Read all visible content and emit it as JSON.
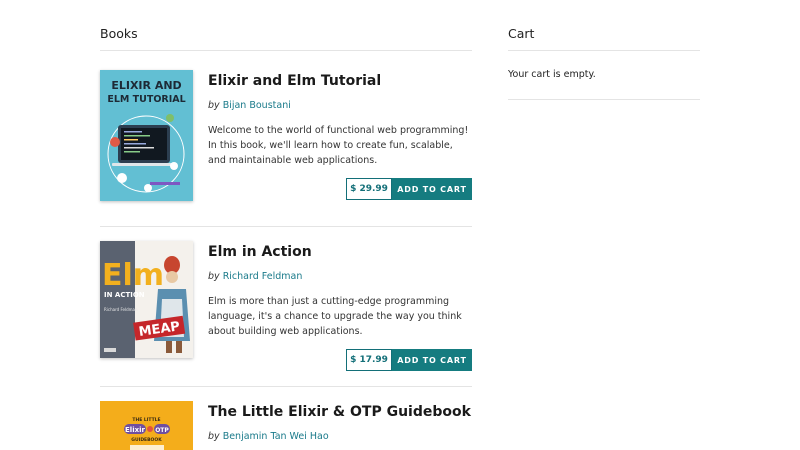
{
  "books_section": {
    "title": "Books"
  },
  "cart_section": {
    "title": "Cart",
    "empty_message": "Your cart is empty."
  },
  "books": [
    {
      "title": "Elixir and Elm Tutorial",
      "by": "by",
      "author": "Bijan Boustani",
      "description": "Welcome to the world of functional web programming! In this book, we'll learn how to create fun, scalable, and maintainable web applications.",
      "price": "$ 29.99",
      "add_label": "ADD TO CART",
      "cover_text": [
        "ELIXIR AND",
        "ELM TUTORIAL"
      ]
    },
    {
      "title": "Elm in Action",
      "by": "by",
      "author": "Richard Feldman",
      "description": "Elm is more than just a cutting-edge programming language, it's a chance to upgrade the way you think about building web applications.",
      "price": "$ 17.99",
      "add_label": "ADD TO CART",
      "cover_text": [
        "Elm",
        "IN ACTION",
        "Richard Feldman",
        "MEAP"
      ]
    },
    {
      "title": "The Little Elixir & OTP Guidebook",
      "by": "by",
      "author": "Benjamin Tan Wei Hao",
      "cover_text": [
        "THE LITTLE",
        "Elixir",
        "OTP",
        "GUIDEBOOK"
      ]
    }
  ],
  "colors": {
    "accent": "#157c80",
    "link": "#1a7a8a",
    "rule": "#e4e4e4"
  }
}
